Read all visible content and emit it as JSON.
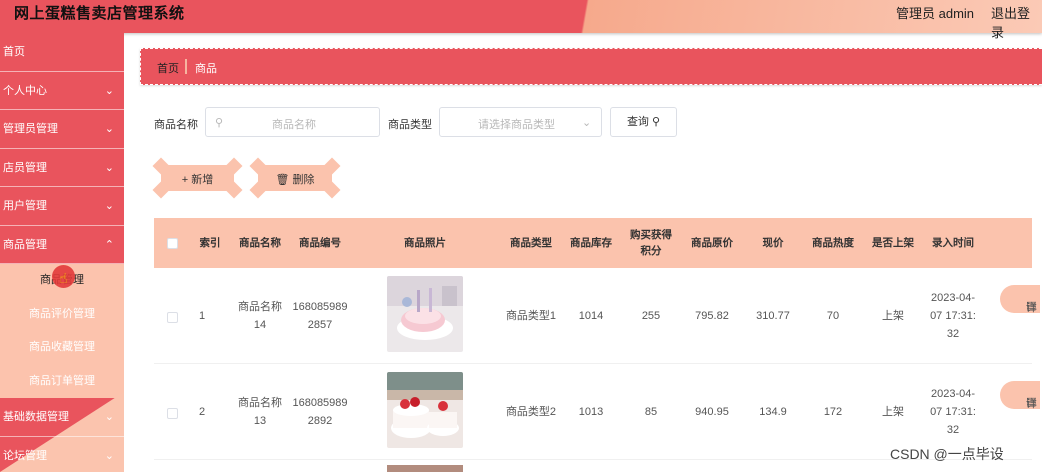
{
  "header": {
    "title": "网上蛋糕售卖店管理系统",
    "admin": "管理员 admin",
    "logout": "退出登录"
  },
  "sidebar": {
    "items": [
      {
        "label": "首页"
      },
      {
        "label": "个人中心"
      },
      {
        "label": "管理员管理"
      },
      {
        "label": "店员管理"
      },
      {
        "label": "用户管理"
      },
      {
        "label": "商品管理"
      }
    ],
    "sub_items": [
      {
        "label": "商品管理"
      },
      {
        "label": "商品评价管理"
      },
      {
        "label": "商品收藏管理"
      },
      {
        "label": "商品订单管理"
      }
    ],
    "items_after": [
      {
        "label": "基础数据管理"
      },
      {
        "label": "论坛管理"
      }
    ]
  },
  "breadcrumb": {
    "home": "首页",
    "current": "商品"
  },
  "search": {
    "name_label": "商品名称",
    "name_placeholder": "商品名称",
    "type_label": "商品类型",
    "type_placeholder": "请选择商品类型",
    "query_label": "查询"
  },
  "actions": {
    "add": "新增",
    "delete": "删除"
  },
  "table": {
    "headers": [
      "索引",
      "商品名称",
      "商品编号",
      "商品照片",
      "商品类型",
      "商品库存",
      "购买获得积分",
      "商品原价",
      "现价",
      "商品热度",
      "是否上架",
      "录入时间"
    ],
    "rows": [
      {
        "index": "1",
        "name": "商品名称14",
        "code": "1680859892857",
        "type": "商品类型1",
        "stock": "1014",
        "points": "255",
        "orig_price": "795.82",
        "price": "310.77",
        "heat": "70",
        "listed": "上架",
        "time": "2023-04-07 17:31:32",
        "action": "详"
      },
      {
        "index": "2",
        "name": "商品名称13",
        "code": "1680859892892",
        "type": "商品类型2",
        "stock": "1013",
        "points": "85",
        "orig_price": "940.95",
        "price": "134.9",
        "heat": "172",
        "listed": "上架",
        "time": "2023-04-07 17:31:32",
        "action": "详"
      }
    ]
  },
  "watermark": "CSDN @一点毕设",
  "colors": {
    "primary": "#e9545d",
    "accent": "#fbc3ad"
  }
}
